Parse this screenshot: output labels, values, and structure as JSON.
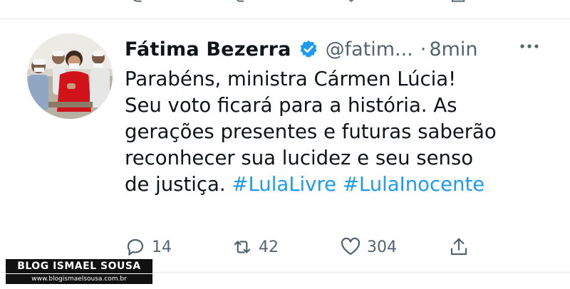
{
  "tweet": {
    "author_name": "Fátima Bezerra",
    "verified_icon": "verified-badge-icon",
    "handle": "@fatim...",
    "separator": "·",
    "time": "8min",
    "text_lines": [
      "Parabéns, ministra Cármen Lúcia!",
      "Seu voto ficará para a história. As",
      "gerações presentes e futuras saberão",
      "reconhecer sua lucidez e seu senso",
      "de justiça."
    ],
    "hashtags": [
      "#LulaLivre",
      "#LulaInocente"
    ],
    "actions": {
      "reply_count": "14",
      "retweet_count": "42",
      "like_count": "304"
    }
  },
  "colors": {
    "accent": "#1d9bf0",
    "muted": "#536471",
    "text": "#0f1419"
  },
  "watermark": {
    "title": "BLOG ISMAEL SOUSA",
    "url": "www.blogismaelsousa.com.br"
  }
}
